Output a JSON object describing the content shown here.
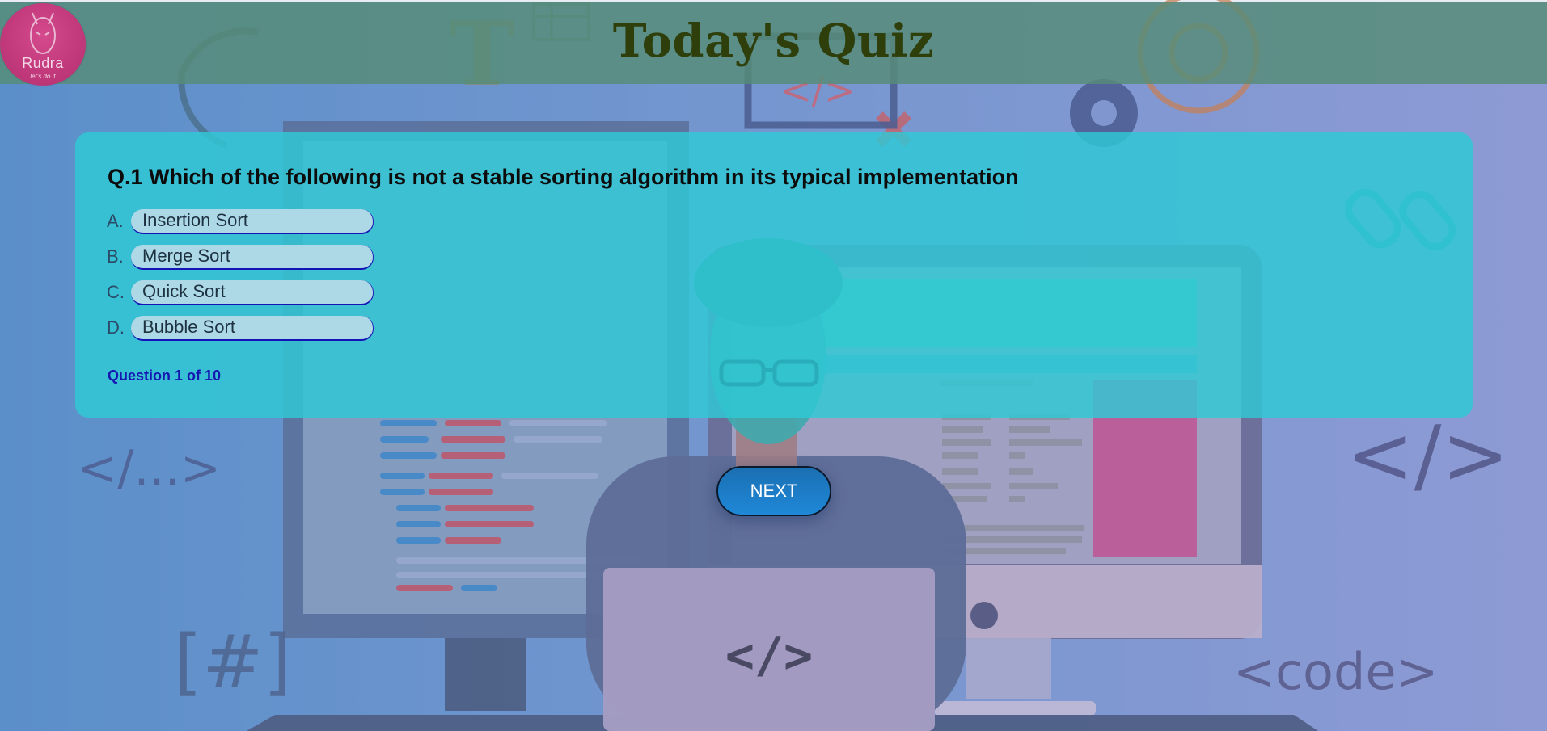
{
  "header": {
    "title": "Today's Quiz",
    "logo": {
      "name": "Rudra",
      "tagline": "let's do it"
    }
  },
  "quiz": {
    "question": "Q.1 Which of the following is not a stable sorting algorithm in its typical implementation",
    "options": [
      {
        "letter": "A.",
        "label": "Insertion Sort"
      },
      {
        "letter": "B.",
        "label": "Merge Sort"
      },
      {
        "letter": "C.",
        "label": "Quick Sort"
      },
      {
        "letter": "D.",
        "label": "Bubble Sort"
      }
    ],
    "progress": "Question 1 of 10",
    "next_label": "NEXT"
  },
  "background": {
    "decor_texts": [
      "</...>",
      "</>",
      "[#]",
      "<code>",
      "</>",
      "T",
      "</>"
    ]
  },
  "colors": {
    "header_band": "#568c76",
    "title": "#2e3f0b",
    "card": "#2ec9d6",
    "option_fill": "#add8e6",
    "progress_text": "#1616b0",
    "next_button": "#1f88d8"
  }
}
